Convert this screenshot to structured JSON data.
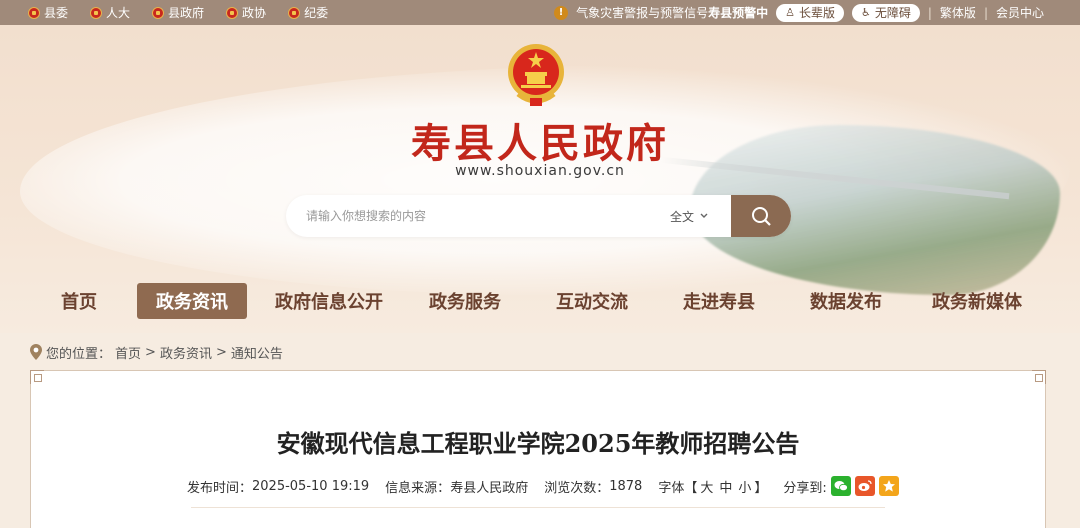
{
  "topbar": {
    "links": [
      {
        "label": "县委",
        "name": "topbar-link-county-committee"
      },
      {
        "label": "人大",
        "name": "topbar-link-npc"
      },
      {
        "label": "县政府",
        "name": "topbar-link-county-gov"
      },
      {
        "label": "政协",
        "name": "topbar-link-cppcc"
      },
      {
        "label": "纪委",
        "name": "topbar-link-discipline"
      }
    ],
    "warning_prefix": "气象灾害警报与预警信号",
    "warning_bold": "寿县预警中",
    "elder_label": "长辈版",
    "accessible_label": "无障碍",
    "traditional_label": "繁体版",
    "member_label": "会员中心",
    "separator": "|"
  },
  "header": {
    "title": "寿县人民政府",
    "url": "www.shouxian.gov.cn"
  },
  "search": {
    "placeholder": "请输入你想搜索的内容",
    "scope": "全文"
  },
  "nav": {
    "items": [
      {
        "label": "首页",
        "active": false
      },
      {
        "label": "政务资讯",
        "active": true
      },
      {
        "label": "政府信息公开",
        "active": false
      },
      {
        "label": "政务服务",
        "active": false
      },
      {
        "label": "互动交流",
        "active": false
      },
      {
        "label": "走进寿县",
        "active": false
      },
      {
        "label": "数据发布",
        "active": false
      },
      {
        "label": "政务新媒体",
        "active": false
      }
    ]
  },
  "breadcrumb": {
    "prefix": "您的位置：",
    "items": [
      "首页",
      "政务资讯",
      "通知公告"
    ],
    "separator": ">"
  },
  "article": {
    "title": "安徽现代信息工程职业学院2025年教师招聘公告",
    "publish_label": "发布时间：",
    "publish_time": "2025-05-10 19:19",
    "source_label": "信息来源：",
    "source": "寿县人民政府",
    "views_label": "浏览次数：",
    "views": "1878",
    "font_label": "字体【",
    "font_large": "大",
    "font_medium": "中",
    "font_small": "小",
    "font_close": "】",
    "share_label": "分享到:"
  },
  "colors": {
    "brand_red": "#c2271b",
    "nav_brown": "#6b4230",
    "active_bg": "#8f6a50",
    "topbar_bg": "#a08a7a",
    "wechat": "#2bb12e",
    "weibo": "#e8562a",
    "qzone": "#f3a51b"
  },
  "icons": {
    "topbar_links": "party-emblem-icon",
    "warning": "warning-icon",
    "elder": "elder-icon",
    "accessible": "wheelchair-icon",
    "search": "search-icon",
    "chevron": "chevron-down-icon",
    "location": "location-pin-icon",
    "share": [
      "wechat-icon",
      "weibo-icon",
      "qzone-icon"
    ]
  }
}
